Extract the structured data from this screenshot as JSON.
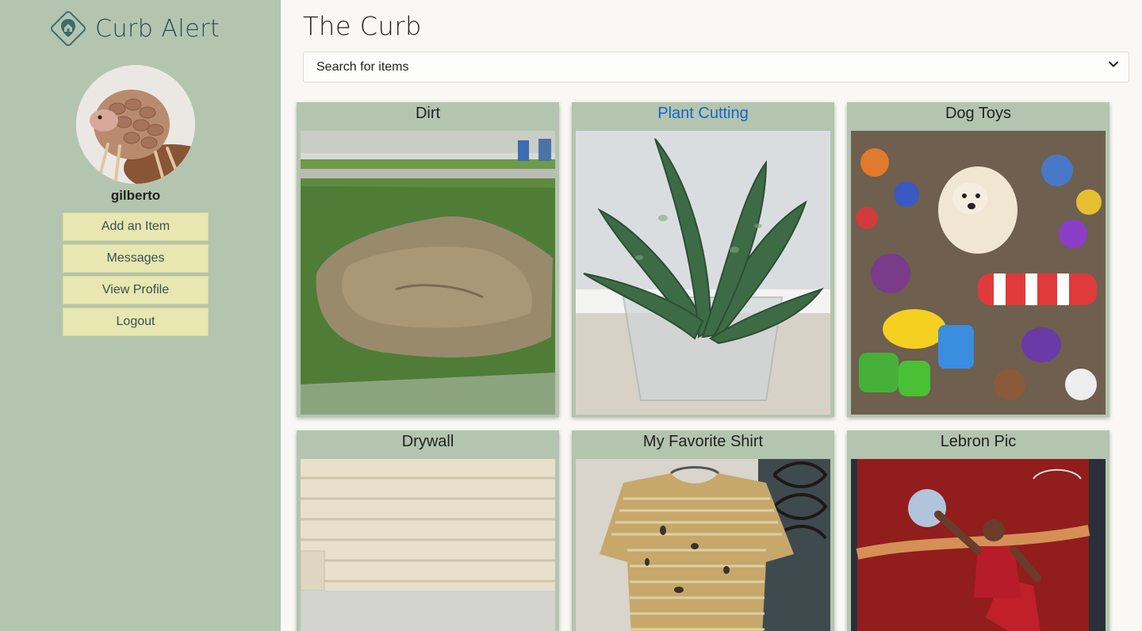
{
  "sidebar": {
    "brand": "Curb Alert",
    "logo_icon": "map-pin-house-icon",
    "avatar_icon": "pangolin-avatar",
    "username": "gilberto",
    "buttons": [
      {
        "label": "Add an Item"
      },
      {
        "label": "Messages"
      },
      {
        "label": "View Profile"
      },
      {
        "label": "Logout"
      }
    ]
  },
  "main": {
    "title": "The Curb",
    "search": {
      "placeholder": "Search for items",
      "icon": "chevron-down-icon"
    },
    "items": [
      {
        "title": "Dirt",
        "image": "dirt-photo"
      },
      {
        "title": "Plant Cutting",
        "image": "plant-photo",
        "highlighted": true
      },
      {
        "title": "Dog Toys",
        "image": "dog-toys-photo"
      },
      {
        "title": "Drywall",
        "image": "drywall-photo"
      },
      {
        "title": "My Favorite Shirt",
        "image": "shirt-photo"
      },
      {
        "title": "Lebron Pic",
        "image": "lebron-photo"
      }
    ]
  },
  "colors": {
    "sidebar_bg": "#b3c5ae",
    "button_bg": "#e8e7b1",
    "link": "#1a64c8",
    "page_bg": "#f9f8f5"
  }
}
